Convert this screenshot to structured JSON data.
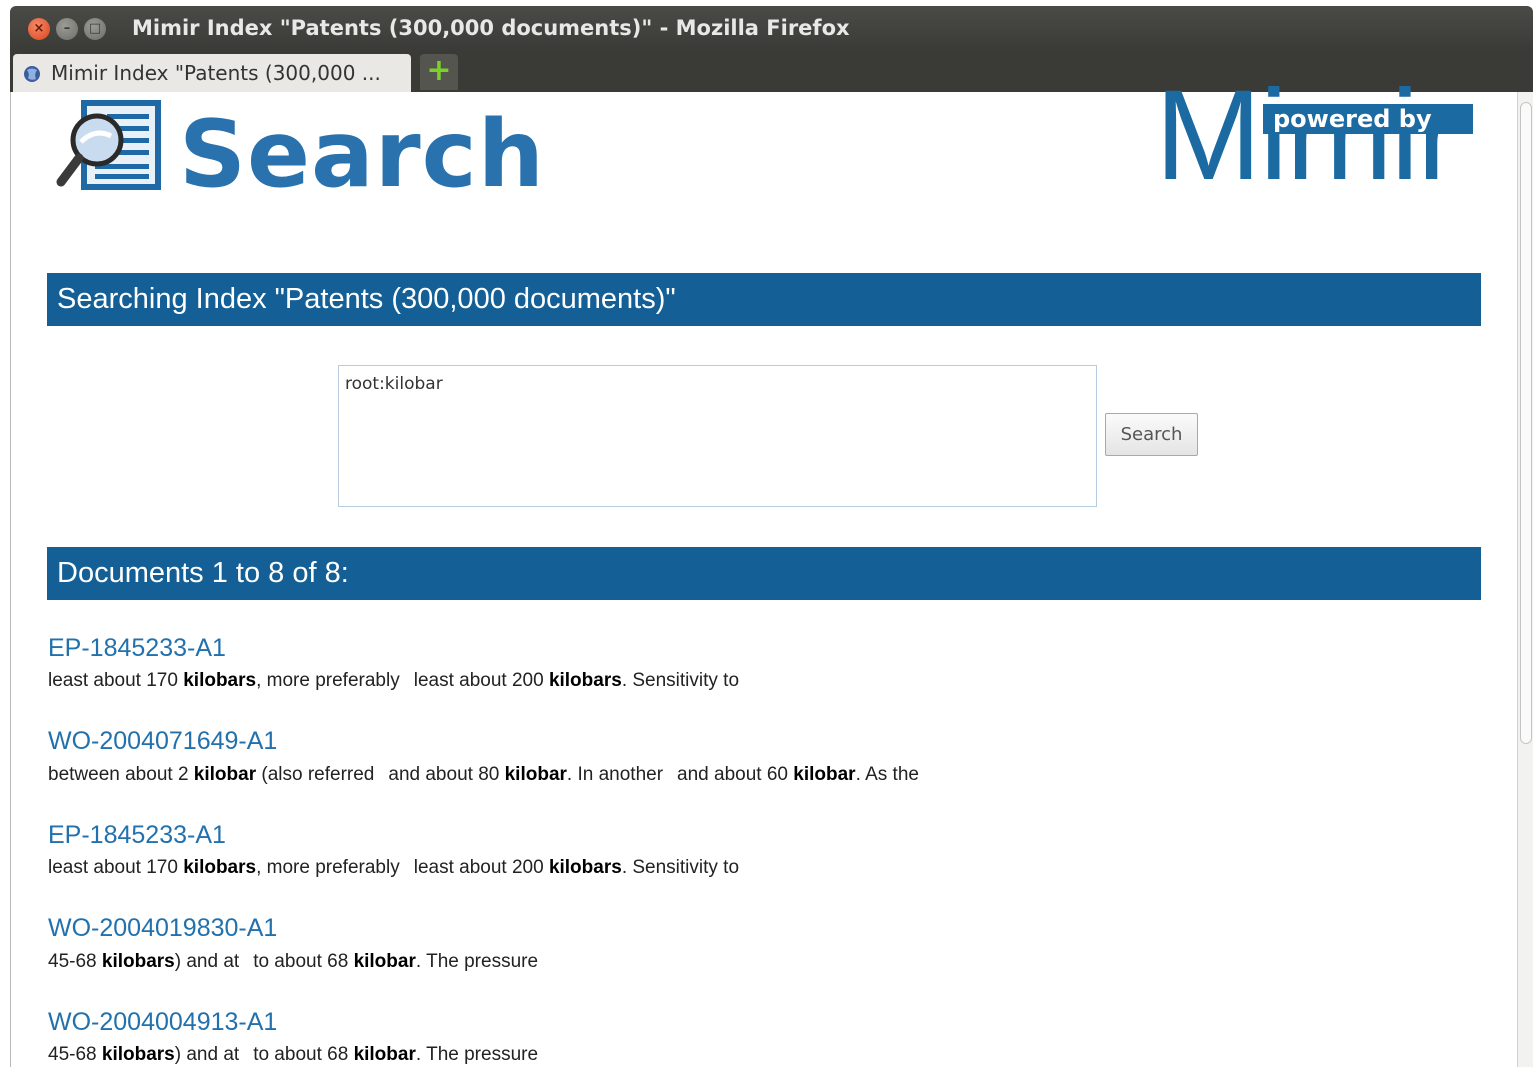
{
  "window": {
    "title": "Mimir Index \"Patents (300,000 documents)\" - Mozilla Firefox",
    "close_glyph": "×",
    "min_glyph": "–",
    "max_glyph": "□"
  },
  "tab": {
    "title": "Mimir Index \"Patents (300,000 ...",
    "icon": "globe-icon",
    "new_tab_icon": "plus-icon",
    "new_tab_glyph": "+"
  },
  "header": {
    "search_logo_text": "Search",
    "mimir_powered_by": "powered by",
    "mimir_logo_text": "Mimir"
  },
  "index_band": {
    "title": "Searching Index \"Patents (300,000 documents)\""
  },
  "search": {
    "query": "root:kilobar",
    "button_label": "Search"
  },
  "results_band": {
    "title": "Documents 1 to 8 of 8:"
  },
  "results": [
    {
      "id": "EP-1845233-A1",
      "snippet": [
        [
          {
            "t": "least about 170 "
          },
          {
            "t": "kilobars",
            "b": true
          },
          {
            "t": ", more preferably"
          }
        ],
        [
          {
            "t": "least about 200 "
          },
          {
            "t": "kilobars",
            "b": true
          },
          {
            "t": ". Sensitivity to"
          }
        ]
      ]
    },
    {
      "id": "WO-2004071649-A1",
      "snippet": [
        [
          {
            "t": "between about 2 "
          },
          {
            "t": "kilobar",
            "b": true
          },
          {
            "t": " (also referred"
          }
        ],
        [
          {
            "t": "and about 80 "
          },
          {
            "t": "kilobar",
            "b": true
          },
          {
            "t": ". In another"
          }
        ],
        [
          {
            "t": "and about 60 "
          },
          {
            "t": "kilobar",
            "b": true
          },
          {
            "t": ". As the"
          }
        ]
      ]
    },
    {
      "id": "EP-1845233-A1",
      "snippet": [
        [
          {
            "t": "least about 170 "
          },
          {
            "t": "kilobars",
            "b": true
          },
          {
            "t": ", more preferably"
          }
        ],
        [
          {
            "t": "least about 200 "
          },
          {
            "t": "kilobars",
            "b": true
          },
          {
            "t": ". Sensitivity to"
          }
        ]
      ]
    },
    {
      "id": "WO-2004019830-A1",
      "snippet": [
        [
          {
            "t": "45-68 "
          },
          {
            "t": "kilobars",
            "b": true
          },
          {
            "t": ") and at"
          }
        ],
        [
          {
            "t": "to about 68 "
          },
          {
            "t": "kilobar",
            "b": true
          },
          {
            "t": ". The pressure"
          }
        ]
      ]
    },
    {
      "id": "WO-2004004913-A1",
      "snippet": [
        [
          {
            "t": "45-68 "
          },
          {
            "t": "kilobars",
            "b": true
          },
          {
            "t": ") and at"
          }
        ],
        [
          {
            "t": "to about 68 "
          },
          {
            "t": "kilobar",
            "b": true
          },
          {
            "t": ". The pressure"
          }
        ]
      ]
    }
  ]
}
